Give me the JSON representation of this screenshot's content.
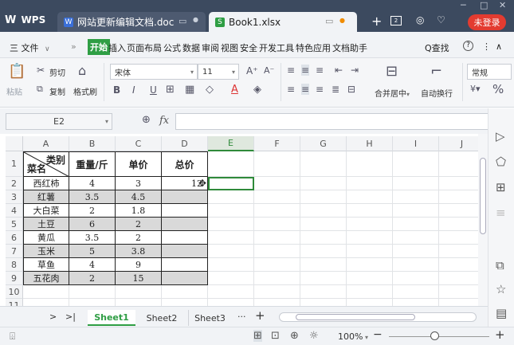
{
  "titlebar": {
    "app_name": "WPS",
    "tabs": [
      {
        "label": "网站更新编辑文档.doc",
        "icon": "W",
        "icon_color": "#3a6fd8"
      },
      {
        "label": "Book1.xlsx",
        "icon": "S",
        "icon_color": "#2f9e44"
      }
    ],
    "new_tab": "+",
    "login_label": "未登录",
    "window_controls": {
      "minimize": "─",
      "maximize": "□",
      "close": "✕"
    }
  },
  "menu": {
    "file_label": "三 文件",
    "file_chevron": "∨",
    "more": "»",
    "items": [
      "开始",
      "插入",
      "页面布局",
      "公式",
      "数据",
      "审阅",
      "视图",
      "安全",
      "开发工具",
      "特色应用",
      "文档助手"
    ],
    "search_label": "Q查找",
    "help": "?",
    "more_dots": "⋮",
    "collapse": "∧"
  },
  "ribbon": {
    "paste_label": "粘贴",
    "cut_label": "剪切",
    "copy_label": "复制",
    "format_painter_label": "格式刷",
    "font_name": "宋体",
    "font_size": "11",
    "bold": "B",
    "italic": "I",
    "underline": "U",
    "merge_center_label": "合并居中",
    "wrap_text_label": "自动换行",
    "number_format": "常规",
    "percent": "%"
  },
  "formula_bar": {
    "name_box": "E2",
    "fx": "fx",
    "formula": ""
  },
  "columns": [
    "A",
    "B",
    "C",
    "D",
    "E",
    "F",
    "G",
    "H",
    "I",
    "J"
  ],
  "rows": [
    "1",
    "2",
    "3",
    "4",
    "5",
    "6",
    "7",
    "8",
    "9",
    "10",
    "11"
  ],
  "table": {
    "header": {
      "category_top": "类别",
      "category_bottom": "菜名",
      "weight": "重量/斤",
      "price": "单价",
      "total": "总价"
    },
    "rows": [
      {
        "name": "西红柿",
        "weight": "4",
        "price": "3",
        "total": "12"
      },
      {
        "name": "红薯",
        "weight": "3.5",
        "price": "4.5",
        "total": ""
      },
      {
        "name": "大白菜",
        "weight": "2",
        "price": "1.8",
        "total": ""
      },
      {
        "name": "土豆",
        "weight": "6",
        "price": "2",
        "total": ""
      },
      {
        "name": "黄瓜",
        "weight": "3.5",
        "price": "2",
        "total": ""
      },
      {
        "name": "玉米",
        "weight": "5",
        "price": "3.8",
        "total": ""
      },
      {
        "name": "草鱼",
        "weight": "4",
        "price": "9",
        "total": ""
      },
      {
        "name": "五花肉",
        "weight": "2",
        "price": "15",
        "total": ""
      }
    ]
  },
  "sheets": {
    "nav_next": ">",
    "nav_last": ">|",
    "tabs": [
      "Sheet1",
      "Sheet2",
      "Sheet3"
    ],
    "more": "···",
    "add": "+"
  },
  "status": {
    "zoom": "100%",
    "zoom_minus": "−",
    "zoom_plus": "+"
  },
  "colors": {
    "titlebar": "#3c4a5f",
    "accent_green": "#2f9e44",
    "login_red": "#e33b30",
    "row_shade": "#d9d9d9"
  }
}
